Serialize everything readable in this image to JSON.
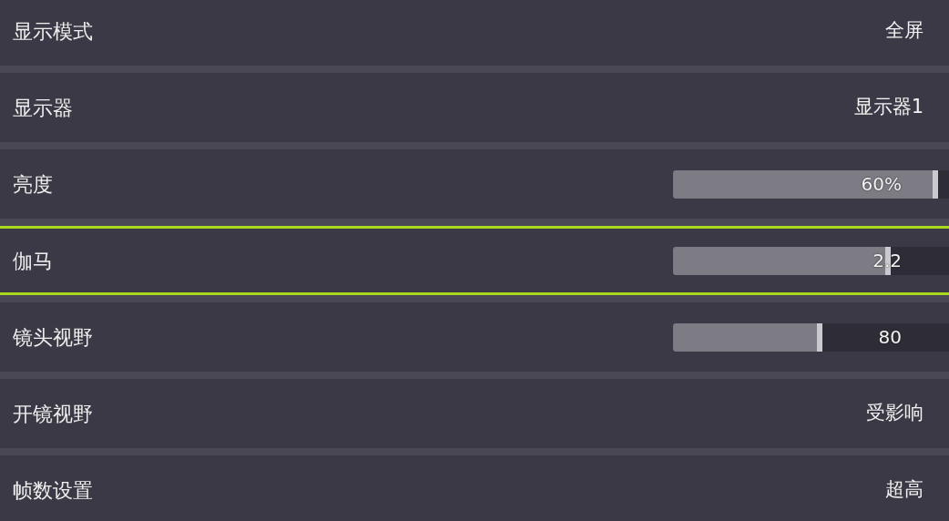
{
  "settings": [
    {
      "kind": "option",
      "label": "显示模式",
      "value": "全屏",
      "selected": false
    },
    {
      "kind": "option",
      "label": "显示器",
      "value": "显示器1",
      "selected": false
    },
    {
      "kind": "slider",
      "label": "亮度",
      "reading": "60%",
      "level": 0.96,
      "selected": false
    },
    {
      "kind": "slider",
      "label": "伽马",
      "reading": "2.2",
      "level": 0.79,
      "selected": true
    },
    {
      "kind": "slider",
      "label": "镜头视野",
      "reading": "80",
      "level": 0.54,
      "selected": false
    },
    {
      "kind": "option",
      "label": "开镜视野",
      "value": "受影响",
      "selected": false
    },
    {
      "kind": "option",
      "label": "帧数设置",
      "value": "超高",
      "selected": false
    }
  ]
}
